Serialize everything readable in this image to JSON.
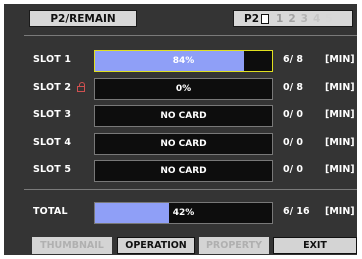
{
  "header": {
    "title": "P2/REMAIN",
    "p2_label": "P2",
    "slot_numbers": [
      "1",
      "2",
      "3",
      "4",
      "5"
    ]
  },
  "slots": [
    {
      "label": "SLOT 1",
      "bar_text": "84%",
      "fill_fraction": 0.84,
      "count": "6/ 8",
      "unit": "[MIN]",
      "locked": false,
      "highlighted": true
    },
    {
      "label": "SLOT 2",
      "bar_text": "0%",
      "fill_fraction": 0,
      "count": "0/ 8",
      "unit": "[MIN]",
      "locked": true,
      "highlighted": false
    },
    {
      "label": "SLOT 3",
      "bar_text": "NO CARD",
      "fill_fraction": 0,
      "count": "0/ 0",
      "unit": "[MIN]",
      "locked": false,
      "highlighted": false
    },
    {
      "label": "SLOT 4",
      "bar_text": "NO CARD",
      "fill_fraction": 0,
      "count": "0/ 0",
      "unit": "[MIN]",
      "locked": false,
      "highlighted": false
    },
    {
      "label": "SLOT 5",
      "bar_text": "NO CARD",
      "fill_fraction": 0,
      "count": "0/ 0",
      "unit": "[MIN]",
      "locked": false,
      "highlighted": false
    }
  ],
  "total": {
    "label": "TOTAL",
    "bar_text": "42%",
    "fill_fraction": 0.42,
    "count": "6/ 16",
    "unit": "[MIN]"
  },
  "tabs": {
    "thumbnail": "THUMBNAIL",
    "operation": "OPERATION",
    "property": "PROPERTY",
    "exit": "EXIT"
  },
  "colors": {
    "background": "#343434",
    "bar_fill": "#8f9ff7",
    "highlight_border": "#e0e020",
    "lock_icon": "#d05050"
  }
}
